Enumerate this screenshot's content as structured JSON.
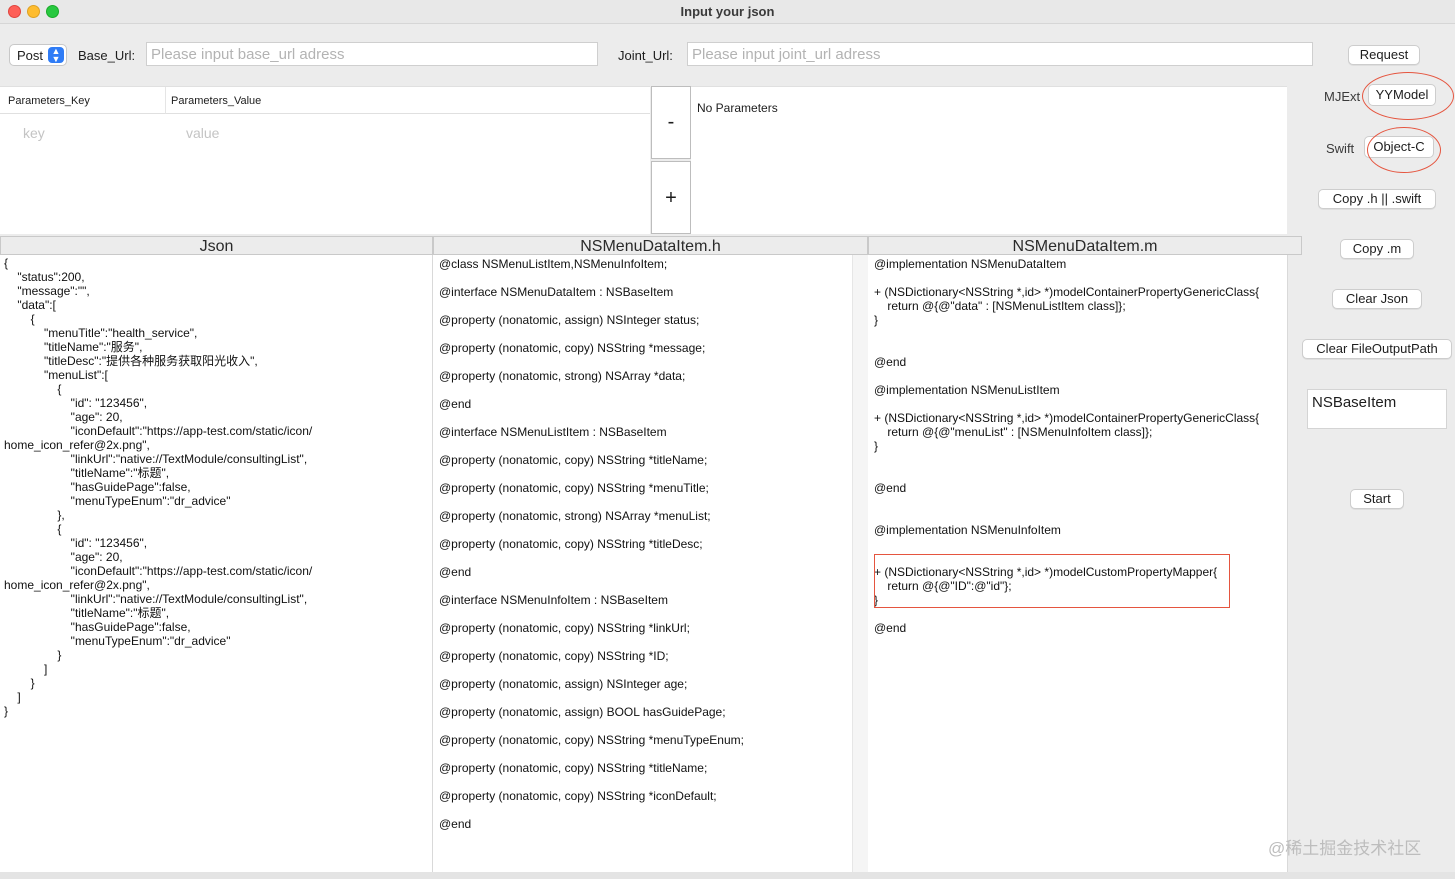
{
  "window": {
    "title": "Input your json"
  },
  "top": {
    "method": "Post",
    "base_url_label": "Base_Url:",
    "base_url_placeholder": "Please input base_url adress",
    "joint_url_label": "Joint_Url:",
    "joint_url_placeholder": "Please input joint_url adress",
    "request_label": "Request"
  },
  "params": {
    "key_header": "Parameters_Key",
    "value_header": "Parameters_Value",
    "key_placeholder": "key",
    "value_placeholder": "value",
    "minus_label": "-",
    "plus_label": "+",
    "no_params": "No Parameters"
  },
  "sidebar": {
    "mjext_label": "MJExt",
    "yymodel_label": "YYModel",
    "swift_label": "Swift",
    "objc_label": "Object-C",
    "copy_h_label": "Copy .h || .swift",
    "copy_m_label": "Copy .m",
    "clear_json_label": "Clear Json",
    "clear_path_label": "Clear FileOutputPath",
    "base_item_value": "NSBaseItem",
    "start_label": "Start"
  },
  "columns": {
    "json_title": "Json",
    "h_title": "NSMenuDataItem.h",
    "m_title": "NSMenuDataItem.m"
  },
  "json_text": "{\n    \"status\":200,\n    \"message\":\"\",\n    \"data\":[\n        {\n            \"menuTitle\":\"health_service\",\n            \"titleName\":\"服务\",\n            \"titleDesc\":\"提供各种服务获取阳光收入\",\n            \"menuList\":[\n                {\n                    \"id\": \"123456\",\n                    \"age\": 20,\n                    \"iconDefault\":\"https://app-test.com/static/icon/\nhome_icon_refer@2x.png\",\n                    \"linkUrl\":\"native://TextModule/consultingList\",\n                    \"titleName\":\"标题\",\n                    \"hasGuidePage\":false,\n                    \"menuTypeEnum\":\"dr_advice\"\n                },\n                {\n                    \"id\": \"123456\",\n                    \"age\": 20,\n                    \"iconDefault\":\"https://app-test.com/static/icon/\nhome_icon_refer@2x.png\",\n                    \"linkUrl\":\"native://TextModule/consultingList\",\n                    \"titleName\":\"标题\",\n                    \"hasGuidePage\":false,\n                    \"menuTypeEnum\":\"dr_advice\"\n                }\n            ]\n        }\n    ]\n}",
  "h_lines": [
    "@class NSMenuListItem,NSMenuInfoItem;",
    "@interface NSMenuDataItem : NSBaseItem",
    "@property (nonatomic, assign) NSInteger status;",
    "@property (nonatomic, copy) NSString *message;",
    "@property (nonatomic, strong) NSArray *data;",
    "@end",
    "@interface NSMenuListItem : NSBaseItem",
    "@property (nonatomic, copy) NSString *titleName;",
    "@property (nonatomic, copy) NSString *menuTitle;",
    "@property (nonatomic, strong) NSArray *menuList;",
    "@property (nonatomic, copy) NSString *titleDesc;",
    "@end",
    "@interface NSMenuInfoItem : NSBaseItem",
    "@property (nonatomic, copy) NSString *linkUrl;",
    "@property (nonatomic, copy) NSString *ID;",
    "@property (nonatomic, assign) NSInteger age;",
    "@property (nonatomic, assign) BOOL hasGuidePage;",
    "@property (nonatomic, copy) NSString *menuTypeEnum;",
    "@property (nonatomic, copy) NSString *titleName;",
    "@property (nonatomic, copy) NSString *iconDefault;",
    "@end"
  ],
  "m_blocks": [
    "@implementation NSMenuDataItem",
    "+ (NSDictionary<NSString *,id> *)modelContainerPropertyGenericClass{\n    return @{@\"data\" : [NSMenuListItem class]};\n}",
    "@end",
    "@implementation NSMenuListItem",
    "+ (NSDictionary<NSString *,id> *)modelContainerPropertyGenericClass{\n    return @{@\"menuList\" : [NSMenuInfoItem class]};\n}",
    "@end",
    "@implementation NSMenuInfoItem",
    "+ (NSDictionary<NSString *,id> *)modelCustomPropertyMapper{\n    return @{@\"ID\":@\"id\"};\n}",
    "@end"
  ],
  "watermark": "@稀土掘金技术社区",
  "colors": {
    "accent": "#2f7cf6",
    "highlight": "#e5553f"
  }
}
